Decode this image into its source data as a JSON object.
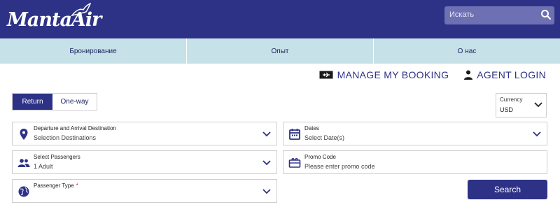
{
  "header": {
    "logo_text": "MantaAir",
    "search_placeholder": "Искать",
    "colors": {
      "brand": "#2d3286",
      "nav_bg": "#c6e1e8",
      "search_bg": "#6d70b3"
    }
  },
  "nav": {
    "items": [
      {
        "label": "Бронирование"
      },
      {
        "label": "Опыт"
      },
      {
        "label": "О нас"
      }
    ]
  },
  "toplinks": {
    "manage_booking": "MANAGE MY BOOKING",
    "agent_login": "AGENT LOGIN"
  },
  "trip": {
    "return_label": "Return",
    "oneway_label": "One-way",
    "selected": "Return"
  },
  "currency": {
    "label": "Currency",
    "value": "USD"
  },
  "form": {
    "destination": {
      "label": "Departure and Arrival Destination",
      "value": "Selection Destinations",
      "icon": "map-pin-icon"
    },
    "dates": {
      "label": "Dates",
      "value": "Select Date(s)",
      "icon": "calendar-icon"
    },
    "passengers": {
      "label": "Select Passengers",
      "value": "1 Adult",
      "icon": "people-icon"
    },
    "promo": {
      "label": "Promo Code",
      "value": "Please enter promo code",
      "icon": "ticket-icon"
    },
    "passenger_type": {
      "label": "Passenger Type",
      "required_mark": "*",
      "icon": "globe-icon"
    }
  },
  "search_button": "Search"
}
